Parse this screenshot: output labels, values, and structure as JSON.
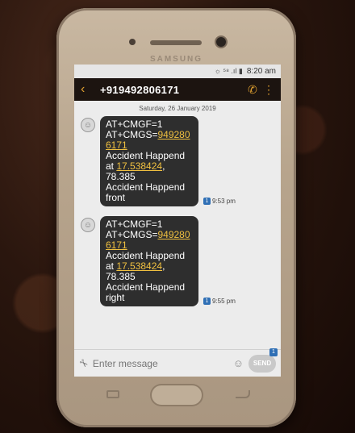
{
  "status_bar": {
    "icons": "☼ ⁵⁸ .ıl ▮",
    "time": "8:20 am"
  },
  "phone": {
    "brand": "SAMSUNG"
  },
  "app_bar": {
    "contact": "+919492806171"
  },
  "conversation": {
    "date": "Saturday, 26 January 2019",
    "messages": [
      {
        "line1": "AT+CMGF=1",
        "line2_prefix": "AT+CMGS=",
        "line2_link": "949280",
        "line3_link": "6171",
        "line4": "Accident Happend",
        "line5_prefix": "at ",
        "line5_link": "17.538424",
        "line5_suffix": ",",
        "line6": "78.385",
        "line7": "Accident Happend",
        "line8": "front",
        "sim": "1",
        "time": "9:53 pm"
      },
      {
        "line1": "AT+CMGF=1",
        "line2_prefix": "AT+CMGS=",
        "line2_link": "949280",
        "line3_link": "6171",
        "line4": "Accident Happend",
        "line5_prefix": "at ",
        "line5_link": "17.538424",
        "line5_suffix": ",",
        "line6": "78.385",
        "line7": "Accident Happend",
        "line8": "right",
        "sim": "1",
        "time": "9:55 pm"
      }
    ]
  },
  "compose": {
    "placeholder": "Enter message",
    "send_label": "SEND",
    "send_sim": "1"
  }
}
